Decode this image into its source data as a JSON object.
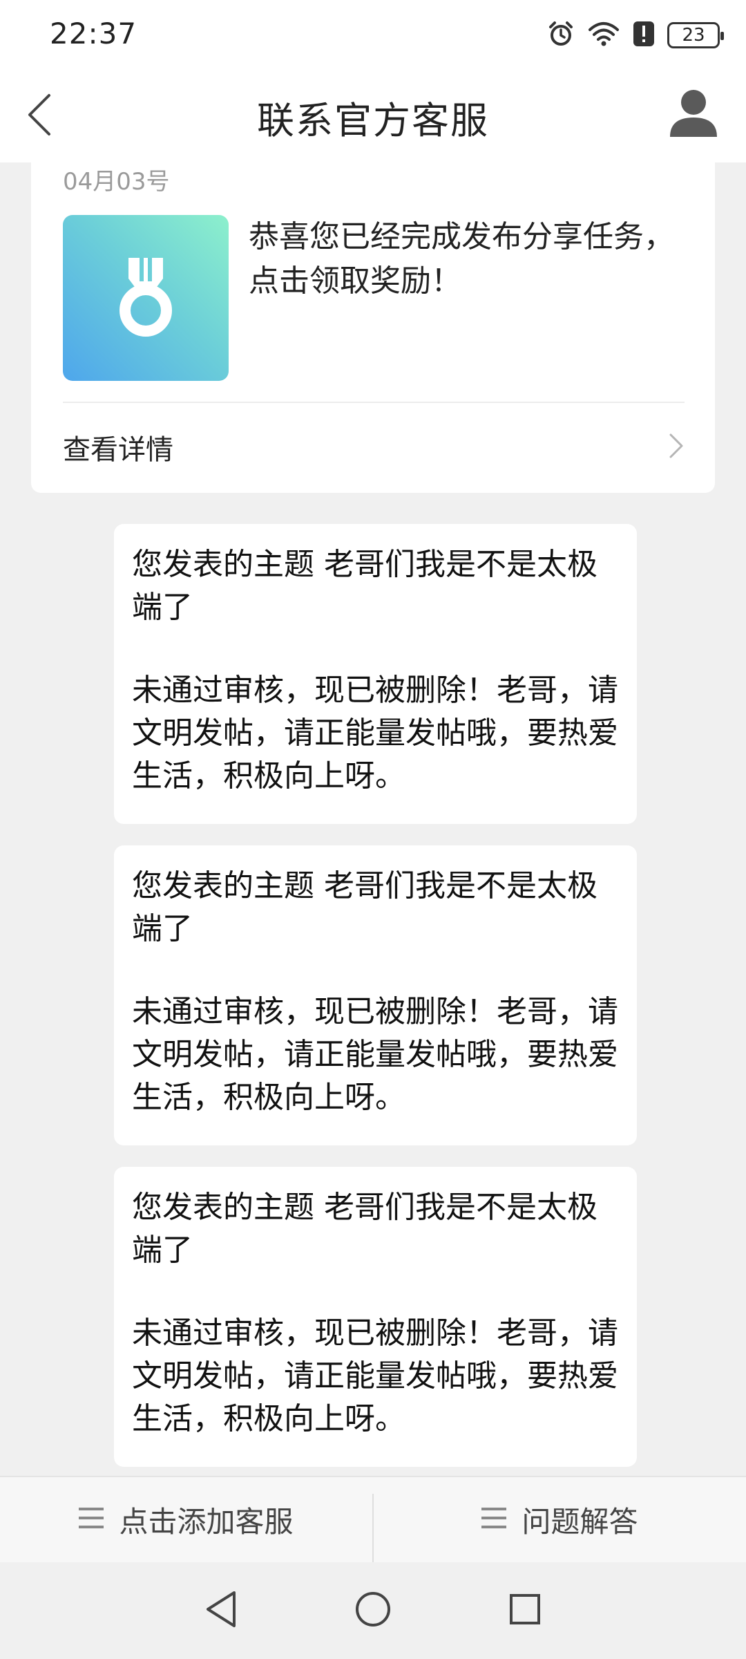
{
  "status_bar": {
    "time": "22:37",
    "battery_level": "23",
    "icons": [
      "alarm-icon",
      "wifi-icon",
      "alert-icon",
      "battery-icon"
    ]
  },
  "header": {
    "title": "联系官方客服",
    "back_icon": "chevron-left-icon",
    "profile_icon": "user-icon"
  },
  "reward_card": {
    "date": "04月03号",
    "icon": "medal-icon",
    "text": "恭喜您已经完成发布分享任务，点击领取奖励！",
    "link_label": "查看详情",
    "link_icon": "chevron-right-icon"
  },
  "messages": [
    {
      "line1": "您发表的主题 老哥们我是不是太极端了",
      "line2": "未通过审核，现已被删除！老哥，请文明发帖，请正能量发帖哦，要热爱生活，积极向上呀。"
    },
    {
      "line1": "您发表的主题 老哥们我是不是太极端了",
      "line2": "未通过审核，现已被删除！老哥，请文明发帖，请正能量发帖哦，要热爱生活，积极向上呀。"
    },
    {
      "line1": "您发表的主题 老哥们我是不是太极端了",
      "line2": "未通过审核，现已被删除！老哥，请文明发帖，请正能量发帖哦，要热爱生活，积极向上呀。"
    }
  ],
  "bottom_tabs": [
    {
      "label": "点击添加客服",
      "icon": "menu-icon"
    },
    {
      "label": "问题解答",
      "icon": "menu-icon"
    }
  ],
  "nav_bar": {
    "icons": [
      "back-triangle-icon",
      "home-circle-icon",
      "recents-square-icon"
    ]
  },
  "colors": {
    "background": "#f0f0f0",
    "card": "#ffffff",
    "date_text": "#9a9a9a",
    "medal_gradient_start": "#4ea6ec",
    "medal_gradient_end": "#8df0cc"
  }
}
